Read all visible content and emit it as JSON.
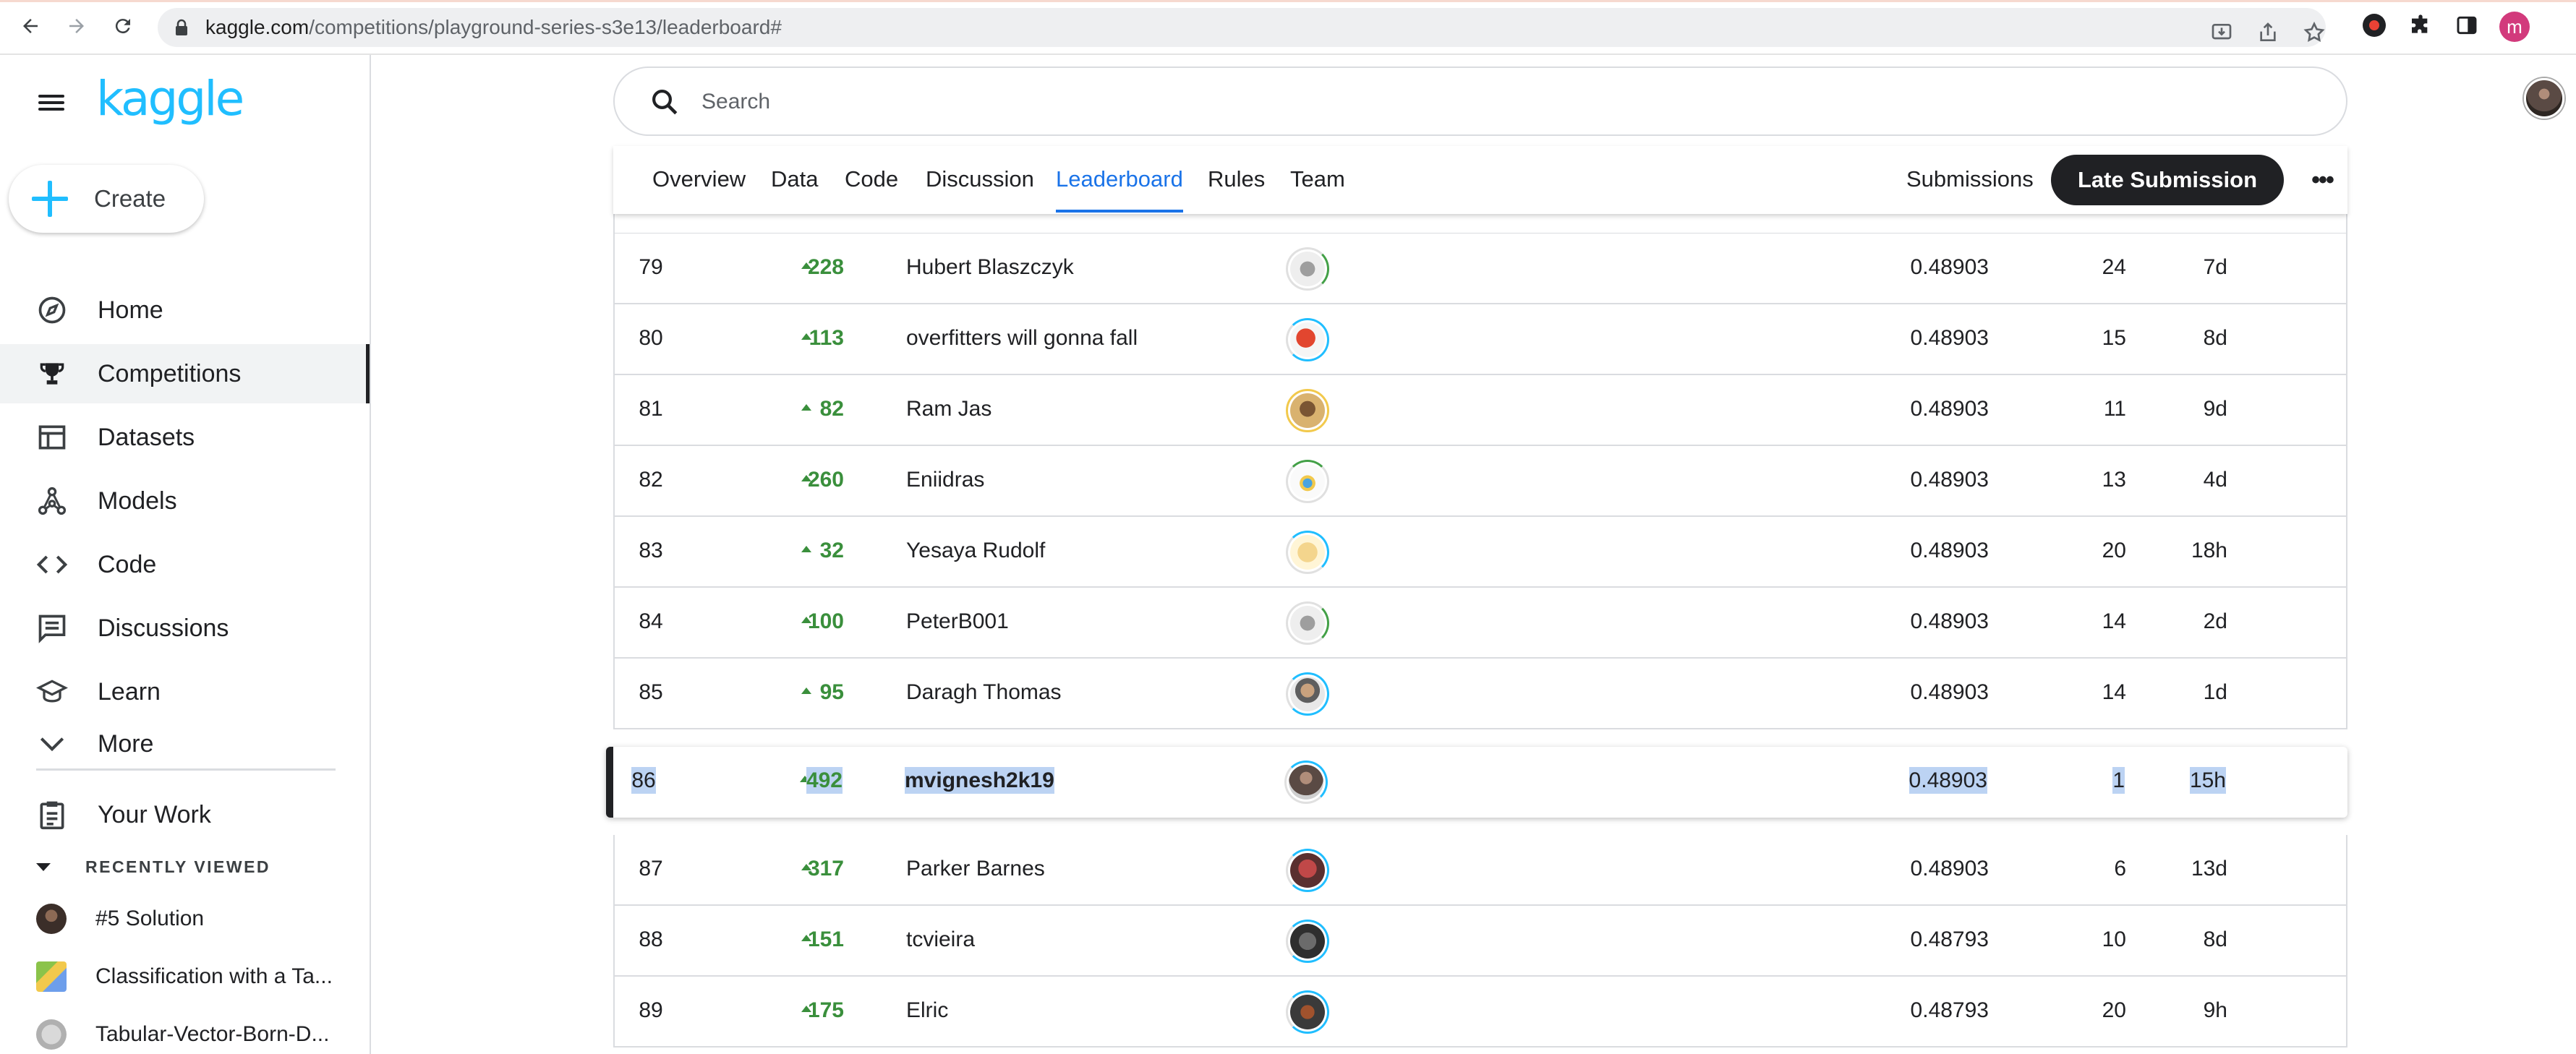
{
  "browser": {
    "url_domain": "kaggle.com",
    "url_path": "/competitions/playground-series-s3e13/leaderboard#",
    "profile_initial": "m"
  },
  "sidebar": {
    "logo": "kaggle",
    "create_label": "Create",
    "items": [
      {
        "label": "Home",
        "icon": "compass-icon"
      },
      {
        "label": "Competitions",
        "icon": "trophy-icon"
      },
      {
        "label": "Datasets",
        "icon": "table-icon"
      },
      {
        "label": "Models",
        "icon": "models-icon"
      },
      {
        "label": "Code",
        "icon": "code-icon"
      },
      {
        "label": "Discussions",
        "icon": "discussion-icon"
      },
      {
        "label": "Learn",
        "icon": "learn-icon"
      },
      {
        "label": "More",
        "icon": "chevron-down-icon"
      }
    ],
    "your_work": "Your Work",
    "recently_viewed_label": "RECENTLY VIEWED",
    "recent": [
      {
        "label": "#5 Solution"
      },
      {
        "label": "Classification with a Ta..."
      },
      {
        "label": "Tabular-Vector-Born-D..."
      }
    ]
  },
  "search": {
    "placeholder": "Search"
  },
  "tabs": {
    "items": [
      "Overview",
      "Data",
      "Code",
      "Discussion",
      "Leaderboard",
      "Rules",
      "Team"
    ],
    "active": "Leaderboard",
    "submissions": "Submissions",
    "late_submission": "Late Submission"
  },
  "leaderboard": {
    "rows": [
      {
        "rank": "79",
        "delta": "228",
        "name": "Hubert Blaszczyk",
        "score": "0.48903",
        "entries": "24",
        "last": "7d"
      },
      {
        "rank": "80",
        "delta": "113",
        "name": "overfitters will gonna fall",
        "score": "0.48903",
        "entries": "15",
        "last": "8d"
      },
      {
        "rank": "81",
        "delta": "82",
        "name": "Ram Jas",
        "score": "0.48903",
        "entries": "11",
        "last": "9d"
      },
      {
        "rank": "82",
        "delta": "260",
        "name": "Eniidras",
        "score": "0.48903",
        "entries": "13",
        "last": "4d"
      },
      {
        "rank": "83",
        "delta": "32",
        "name": "Yesaya Rudolf",
        "score": "0.48903",
        "entries": "20",
        "last": "18h"
      },
      {
        "rank": "84",
        "delta": "100",
        "name": "PeterB001",
        "score": "0.48903",
        "entries": "14",
        "last": "2d"
      },
      {
        "rank": "85",
        "delta": "95",
        "name": "Daragh Thomas",
        "score": "0.48903",
        "entries": "14",
        "last": "1d"
      }
    ],
    "me": {
      "rank": "86",
      "delta": "492",
      "name": "mvignesh2k19",
      "score": "0.48903",
      "entries": "1",
      "last": "15h"
    },
    "rows_after": [
      {
        "rank": "87",
        "delta": "317",
        "name": "Parker Barnes",
        "score": "0.48903",
        "entries": "6",
        "last": "13d"
      },
      {
        "rank": "88",
        "delta": "151",
        "name": "tcvieira",
        "score": "0.48793",
        "entries": "10",
        "last": "8d"
      },
      {
        "rank": "89",
        "delta": "175",
        "name": "Elric",
        "score": "0.48793",
        "entries": "20",
        "last": "9h"
      }
    ]
  }
}
